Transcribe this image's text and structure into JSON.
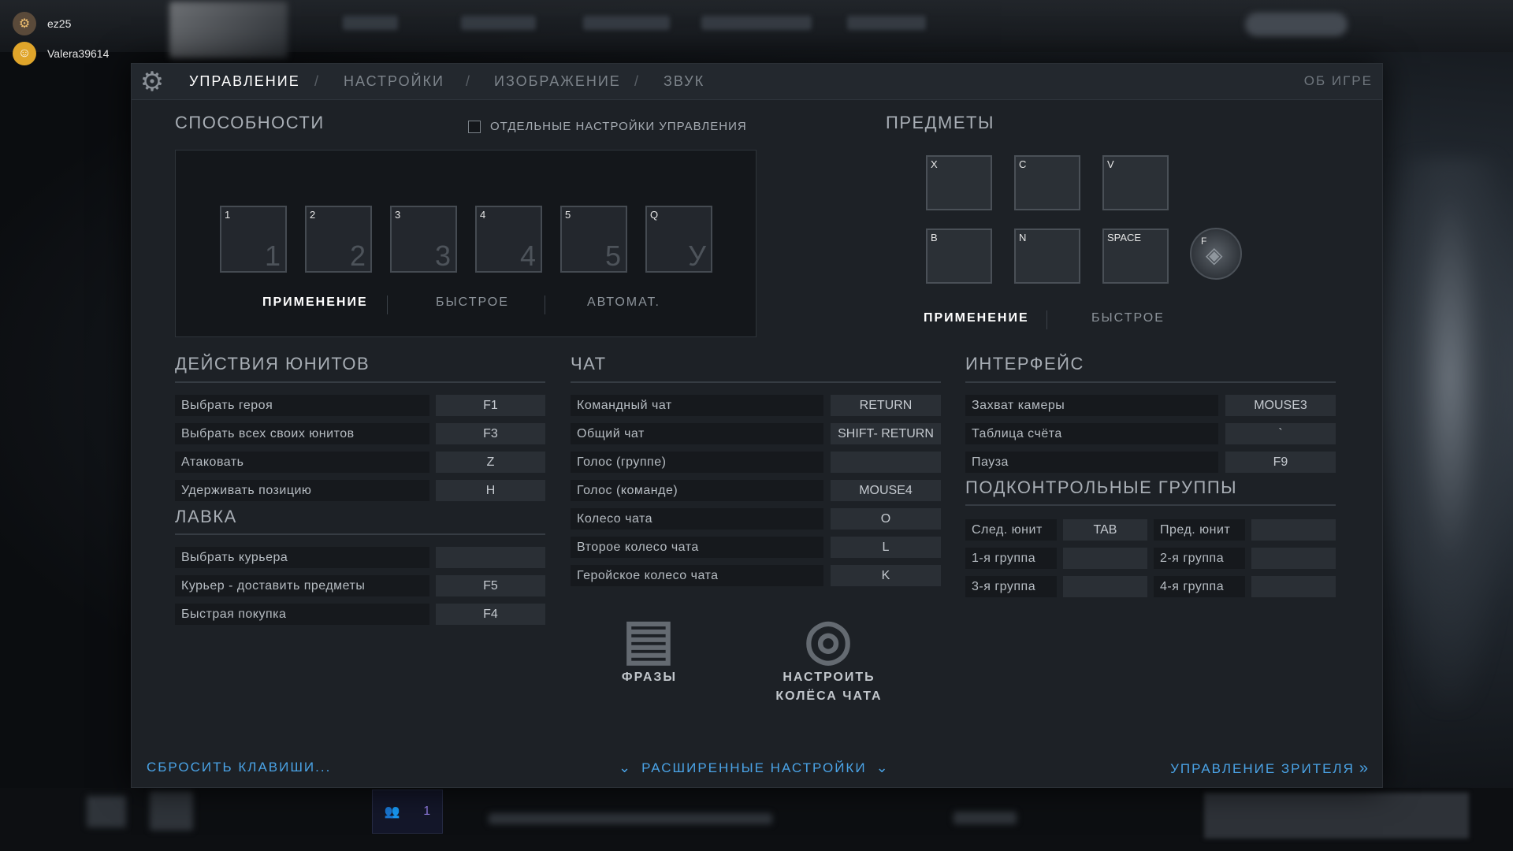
{
  "friends": [
    {
      "name": "ez25",
      "avatar_icon": "robot-icon"
    },
    {
      "name": "Valera39614",
      "avatar_icon": "smiley-icon"
    }
  ],
  "party": {
    "count": "1"
  },
  "tabs": {
    "controls": "УПРАВЛЕНИЕ",
    "settings": "НАСТРОЙКИ",
    "image": "ИЗОБРАЖЕНИЕ",
    "sound": "ЗВУК",
    "separator": "/",
    "about": "ОБ ИГРЕ"
  },
  "abilities": {
    "title": "СПОСОБНОСТИ",
    "separate_checkbox_label": "ОТДЕЛЬНЫЕ НАСТРОЙКИ УПРАВЛЕНИЯ",
    "slots": [
      {
        "key": "1",
        "bind": "1"
      },
      {
        "key": "2",
        "bind": "2"
      },
      {
        "key": "3",
        "bind": "3"
      },
      {
        "key": "4",
        "bind": "4"
      },
      {
        "key": "5",
        "bind": "5"
      },
      {
        "key": "Q",
        "bind": "У"
      }
    ],
    "modes": [
      "ПРИМЕНЕНИЕ",
      "БЫСТРОЕ",
      "АВТОМАТ."
    ]
  },
  "items": {
    "title": "ПРЕДМЕТЫ",
    "slots": [
      "X",
      "C",
      "V",
      "B",
      "N",
      "SPACE"
    ],
    "tp_key": "F",
    "modes": [
      "ПРИМЕНЕНИЕ",
      "БЫСТРОЕ"
    ]
  },
  "unit_actions": {
    "title": "ДЕЙСТВИЯ ЮНИТОВ",
    "rows": [
      {
        "label": "Выбрать героя",
        "key": "F1"
      },
      {
        "label": "Выбрать всех своих юнитов",
        "key": "F3"
      },
      {
        "label": "Атаковать",
        "key": "Z"
      },
      {
        "label": "Удерживать позицию",
        "key": "H"
      }
    ]
  },
  "shop": {
    "title": "ЛАВКА",
    "rows": [
      {
        "label": "Выбрать курьера",
        "key": ""
      },
      {
        "label": "Курьер - доставить предметы",
        "key": "F5"
      },
      {
        "label": "Быстрая покупка",
        "key": "F4"
      }
    ]
  },
  "chat": {
    "title": "ЧАТ",
    "rows": [
      {
        "label": "Командный чат",
        "key": "RETURN"
      },
      {
        "label": "Общий чат",
        "key": "SHIFT- RETURN"
      },
      {
        "label": "Голос (группе)",
        "key": ""
      },
      {
        "label": "Голос (команде)",
        "key": "MOUSE4"
      },
      {
        "label": "Колесо чата",
        "key": "O"
      },
      {
        "label": "Второе колесо чата",
        "key": "L"
      },
      {
        "label": "Геройское колесо чата",
        "key": "K"
      }
    ],
    "phrases_label": "ФРАЗЫ",
    "wheels_label_1": "НАСТРОИТЬ",
    "wheels_label_2": "КОЛЁСА ЧАТА"
  },
  "interface": {
    "title": "ИНТЕРФЕЙС",
    "rows": [
      {
        "label": "Захват камеры",
        "key": "MOUSE3"
      },
      {
        "label": "Таблица счёта",
        "key": "`"
      },
      {
        "label": "Пауза",
        "key": "F9"
      }
    ]
  },
  "control_groups": {
    "title": "ПОДКОНТРОЛЬНЫЕ ГРУППЫ",
    "rows": [
      {
        "label": "След. юнит",
        "key": "TAB",
        "label2": "Пред. юнит",
        "key2": ""
      },
      {
        "label": "1-я группа",
        "key": "",
        "label2": "2-я группа",
        "key2": ""
      },
      {
        "label": "3-я группа",
        "key": "",
        "label2": "4-я группа",
        "key2": ""
      }
    ]
  },
  "footer": {
    "reset": "СБРОСИТЬ КЛАВИШИ...",
    "advanced": "РАСШИРЕННЫЕ НАСТРОЙКИ",
    "spectator": "УПРАВЛЕНИЕ ЗРИТЕЛЯ"
  },
  "colors": {
    "accent": "#4aa3e6",
    "panel": "#1d2126",
    "active_text": "#ffffff"
  }
}
